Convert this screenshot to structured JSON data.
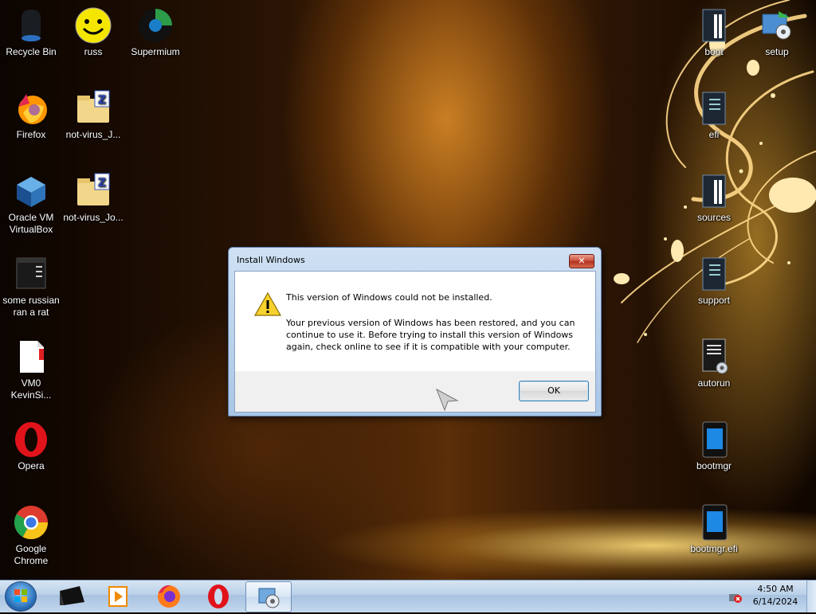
{
  "desktop_left": [
    {
      "label": "Recycle Bin",
      "icon": "recycle-bin-icon"
    },
    {
      "label": "russ",
      "icon": "smiley-face-icon"
    },
    {
      "label": "Supermium",
      "icon": "supermium-browser-icon"
    },
    {
      "label": "Firefox",
      "icon": "firefox-icon"
    },
    {
      "label": "not-virus_J...",
      "icon": "zip-folder-icon"
    },
    {
      "label": "Oracle VM\nVirtualBox",
      "icon": "virtualbox-icon"
    },
    {
      "label": "not-virus_Jo...",
      "icon": "zip-folder-icon"
    },
    {
      "label": "some russian\nran a rat",
      "icon": "executable-icon"
    },
    {
      "label": "VM0\nKevinSi...",
      "icon": "shortcut-file-icon"
    },
    {
      "label": "Opera",
      "icon": "opera-icon"
    },
    {
      "label": "Google\nChrome",
      "icon": "chrome-icon"
    }
  ],
  "desktop_right": [
    {
      "label": "boot",
      "icon": "folder-icon"
    },
    {
      "label": "setup",
      "icon": "setup-installer-icon"
    },
    {
      "label": "efi",
      "icon": "folder-icon"
    },
    {
      "label": "sources",
      "icon": "folder-icon"
    },
    {
      "label": "support",
      "icon": "folder-icon"
    },
    {
      "label": "autorun",
      "icon": "settings-file-icon"
    },
    {
      "label": "bootmgr",
      "icon": "system-file-icon"
    },
    {
      "label": "bootmgr.efi",
      "icon": "system-file-icon"
    }
  ],
  "dialog": {
    "title": "Install Windows",
    "close_label": "✕",
    "message_main": "This version of Windows could not be installed.",
    "message_detail": "Your previous version of Windows has been restored, and you can\ncontinue to use it.  Before trying to install this version of Windows\nagain, check online to see if it is compatible with your computer.",
    "ok_label": "OK"
  },
  "taskbar": {
    "pinned": [
      {
        "name": "start-button",
        "icon": "windows-orb-icon"
      },
      {
        "name": "taskbar-explorer",
        "icon": "folder-dark-icon"
      },
      {
        "name": "taskbar-media-player",
        "icon": "media-player-icon"
      },
      {
        "name": "taskbar-firefox",
        "icon": "firefox-icon"
      },
      {
        "name": "taskbar-opera",
        "icon": "opera-icon"
      },
      {
        "name": "taskbar-setup",
        "icon": "setup-installer-icon"
      }
    ],
    "clock_time": "4:50 AM",
    "clock_date": "6/14/2024",
    "tray_icon": "network-error-icon"
  },
  "colors": {
    "dialog_frame": "#a9c6e6",
    "close_red": "#c74a36",
    "taskbar": "#b9d0e8"
  }
}
